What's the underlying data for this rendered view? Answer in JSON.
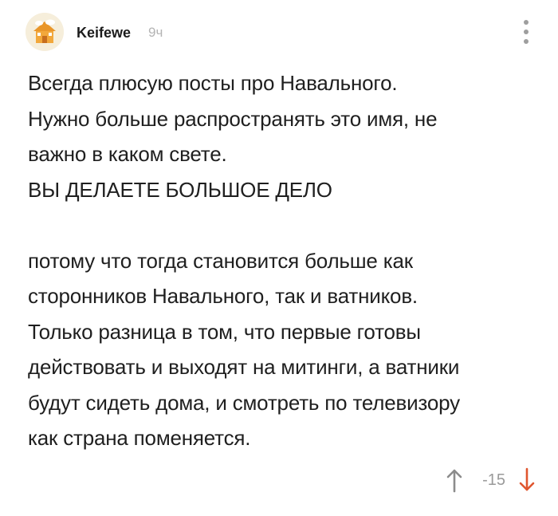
{
  "comment": {
    "author": "Keifewe",
    "time": "9ч",
    "avatar_icon": "house-avatar-icon",
    "more_icon": "vertical-dots-icon",
    "paragraph1": [
      "Всегда плюсую посты про Навального.",
      "Нужно больше распространять это имя, не",
      "важно в каком свете.",
      "ВЫ ДЕЛАЕТЕ БОЛЬШОЕ ДЕЛО"
    ],
    "paragraph2": [
      "потому что тогда становится больше как",
      "сторонников Навального, так и ватников.",
      "Только разница в том, что первые готовы",
      "действовать и выходят на митинги, а ватники",
      "будут сидеть дома, и смотреть по телевизору",
      "как страна поменяется."
    ],
    "rating": "-15",
    "colors": {
      "upvote": "#8c8c8c",
      "downvote": "#e0562f",
      "rating": "#9a9a9a",
      "time": "#b4b4b4"
    }
  }
}
